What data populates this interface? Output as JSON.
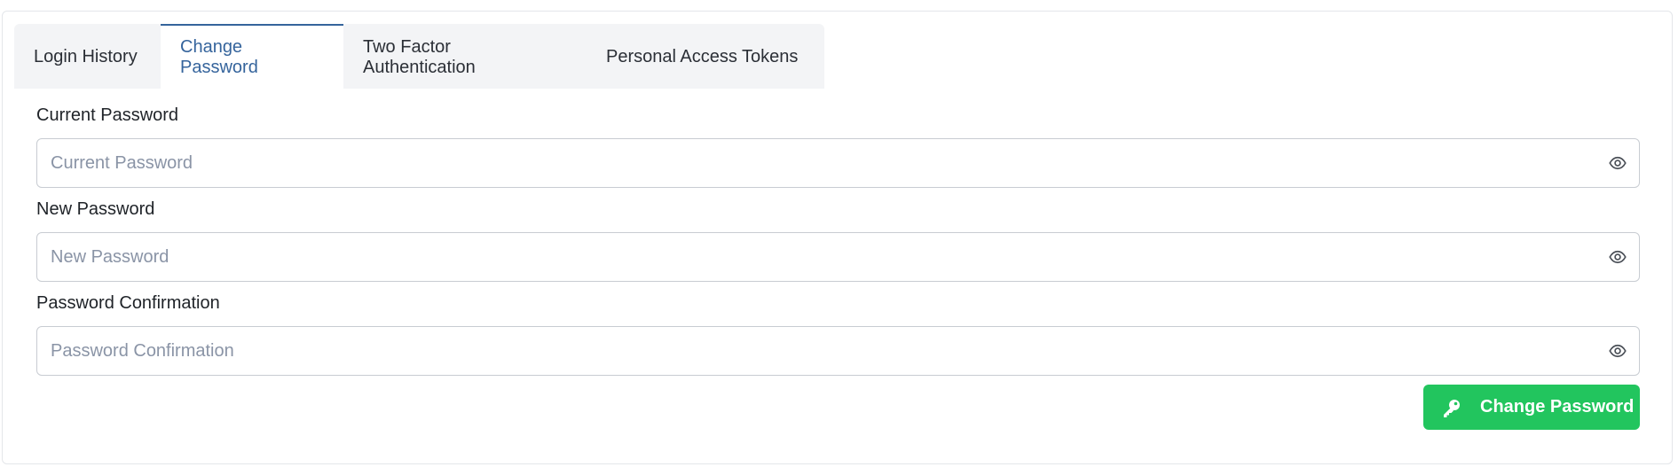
{
  "tabs": [
    {
      "label": "Login History",
      "active": false
    },
    {
      "label": "Change Password",
      "active": true
    },
    {
      "label": "Two Factor Authentication",
      "active": false
    },
    {
      "label": "Personal Access Tokens",
      "active": false
    }
  ],
  "form": {
    "current_password": {
      "label": "Current Password",
      "placeholder": "Current Password",
      "value": "",
      "icon": "eye-icon"
    },
    "new_password": {
      "label": "New Password",
      "placeholder": "New Password",
      "value": "",
      "icon": "eye-icon"
    },
    "password_confirmation": {
      "label": "Password Confirmation",
      "placeholder": "Password Confirmation",
      "value": "",
      "icon": "eye-icon"
    }
  },
  "submit": {
    "label": "Change Password",
    "icon": "key-icon"
  },
  "colors": {
    "accent": "#35649c",
    "button": "#22c55e",
    "tab_background": "#f3f4f6",
    "placeholder": "#8a94a6"
  }
}
